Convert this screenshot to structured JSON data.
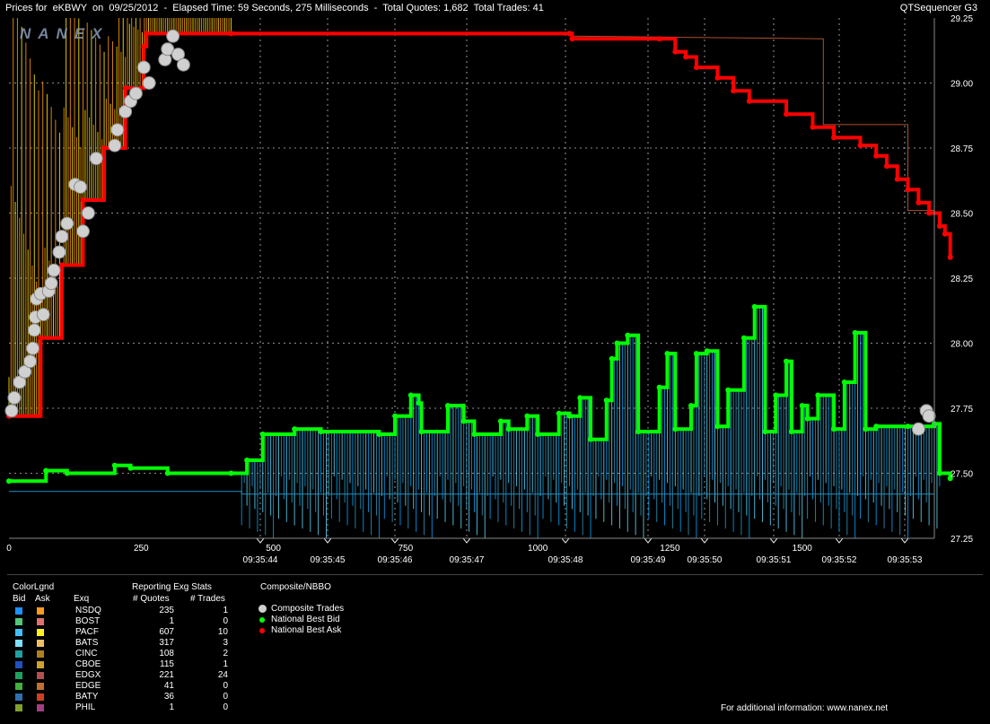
{
  "title": {
    "left": "Prices for  eKBWY  on  09/25/2012  -  Elapsed Time: 59 Seconds, 275 Milliseconds  -  Total Quotes: 1,682  Total Trades: 41",
    "right": "QTSequencer G3",
    "watermark": "NANEX"
  },
  "chart_data": {
    "type": "line",
    "y_axis": {
      "ticks": [
        "29.25",
        "29.00",
        "28.75",
        "28.50",
        "28.25",
        "28.00",
        "27.75",
        "27.50",
        "27.25"
      ],
      "ylim": [
        27.25,
        29.25
      ],
      "side": "right"
    },
    "x_axis_sequence": {
      "ticks": [
        "0",
        "250",
        "500",
        "750",
        "1000",
        "1250",
        "1500"
      ],
      "xlim": [
        0,
        1750
      ]
    },
    "x_axis_time": {
      "ticks": [
        "09:35:44",
        "09:35:45",
        "09:35:46",
        "09:35:47",
        "09:35:48",
        "09:35:49",
        "09:35:50",
        "09:35:51",
        "09:35:52",
        "09:35:53"
      ]
    },
    "grid": true,
    "colors": {
      "bid": "#00ff00",
      "ask": "#ff0000",
      "trade": "#d0d0d0",
      "nsdq_ask": "#ff9900",
      "pacf_ask": "#ffee00",
      "nsdq_bid": "#00aaff",
      "bats_bid": "#66ddff",
      "edgx_bid": "#3399bb"
    },
    "series": [
      {
        "name": "National Best Ask",
        "points": [
          [
            0,
            27.72
          ],
          [
            60,
            28.02
          ],
          [
            100,
            28.3
          ],
          [
            140,
            28.55
          ],
          [
            180,
            28.75
          ],
          [
            220,
            28.98
          ],
          [
            255,
            29.14
          ],
          [
            260,
            29.19
          ],
          [
            420,
            29.19
          ],
          [
            1060,
            29.19
          ],
          [
            1065,
            29.17
          ],
          [
            1230,
            29.17
          ],
          [
            1260,
            29.12
          ],
          [
            1280,
            29.1
          ],
          [
            1300,
            29.06
          ],
          [
            1340,
            29.02
          ],
          [
            1370,
            28.97
          ],
          [
            1400,
            28.93
          ],
          [
            1470,
            28.88
          ],
          [
            1520,
            28.83
          ],
          [
            1560,
            28.79
          ],
          [
            1610,
            28.76
          ],
          [
            1640,
            28.72
          ],
          [
            1660,
            28.68
          ],
          [
            1680,
            28.63
          ],
          [
            1700,
            28.59
          ],
          [
            1720,
            28.54
          ],
          [
            1740,
            28.5
          ],
          [
            1760,
            28.45
          ],
          [
            1770,
            28.42
          ],
          [
            1780,
            28.33
          ]
        ]
      },
      {
        "name": "National Best Bid",
        "points": [
          [
            0,
            27.47
          ],
          [
            70,
            27.51
          ],
          [
            110,
            27.5
          ],
          [
            200,
            27.53
          ],
          [
            230,
            27.52
          ],
          [
            300,
            27.5
          ],
          [
            420,
            27.5
          ],
          [
            450,
            27.55
          ],
          [
            480,
            27.65
          ],
          [
            540,
            27.67
          ],
          [
            590,
            27.66
          ],
          [
            700,
            27.65
          ],
          [
            730,
            27.72
          ],
          [
            760,
            27.8
          ],
          [
            775,
            27.77
          ],
          [
            780,
            27.66
          ],
          [
            830,
            27.76
          ],
          [
            860,
            27.7
          ],
          [
            880,
            27.65
          ],
          [
            930,
            27.7
          ],
          [
            945,
            27.67
          ],
          [
            980,
            27.72
          ],
          [
            1000,
            27.65
          ],
          [
            1040,
            27.73
          ],
          [
            1060,
            27.72
          ],
          [
            1080,
            27.79
          ],
          [
            1100,
            27.63
          ],
          [
            1130,
            27.78
          ],
          [
            1140,
            27.94
          ],
          [
            1150,
            28.0
          ],
          [
            1170,
            28.03
          ],
          [
            1190,
            27.66
          ],
          [
            1230,
            27.83
          ],
          [
            1245,
            27.96
          ],
          [
            1260,
            27.67
          ],
          [
            1290,
            27.76
          ],
          [
            1300,
            27.96
          ],
          [
            1320,
            27.97
          ],
          [
            1340,
            27.68
          ],
          [
            1360,
            27.82
          ],
          [
            1390,
            28.02
          ],
          [
            1410,
            28.14
          ],
          [
            1430,
            27.66
          ],
          [
            1450,
            27.8
          ],
          [
            1470,
            27.93
          ],
          [
            1480,
            27.66
          ],
          [
            1500,
            27.76
          ],
          [
            1510,
            27.71
          ],
          [
            1530,
            27.8
          ],
          [
            1560,
            27.67
          ],
          [
            1580,
            27.85
          ],
          [
            1600,
            28.04
          ],
          [
            1620,
            27.67
          ],
          [
            1640,
            27.68
          ],
          [
            1700,
            27.68
          ],
          [
            1750,
            27.69
          ],
          [
            1760,
            27.5
          ],
          [
            1780,
            27.48
          ]
        ]
      },
      {
        "name": "Composite Trades",
        "points": [
          [
            5,
            27.74
          ],
          [
            10,
            27.79
          ],
          [
            20,
            27.85
          ],
          [
            30,
            27.89
          ],
          [
            40,
            27.93
          ],
          [
            45,
            27.98
          ],
          [
            48,
            28.05
          ],
          [
            50,
            28.1
          ],
          [
            52,
            28.17
          ],
          [
            60,
            28.19
          ],
          [
            65,
            28.11
          ],
          [
            75,
            28.2
          ],
          [
            80,
            28.23
          ],
          [
            85,
            28.28
          ],
          [
            95,
            28.35
          ],
          [
            100,
            28.41
          ],
          [
            110,
            28.46
          ],
          [
            125,
            28.61
          ],
          [
            135,
            28.6
          ],
          [
            140,
            28.43
          ],
          [
            150,
            28.5
          ],
          [
            165,
            28.71
          ],
          [
            200,
            28.76
          ],
          [
            205,
            28.82
          ],
          [
            220,
            28.89
          ],
          [
            230,
            28.93
          ],
          [
            240,
            28.96
          ],
          [
            255,
            29.06
          ],
          [
            265,
            29.0
          ],
          [
            295,
            29.09
          ],
          [
            300,
            29.13
          ],
          [
            310,
            29.18
          ],
          [
            320,
            29.11
          ],
          [
            330,
            29.07
          ],
          [
            1720,
            27.67
          ],
          [
            1735,
            27.74
          ],
          [
            1740,
            27.72
          ]
        ]
      }
    ]
  },
  "legend": {
    "header_colorlgnd": "ColorLgnd",
    "header_bid": "Bid",
    "header_ask": "Ask",
    "header_exq": "Exq",
    "header_stats": "Reporting Exg Stats",
    "header_quotes": "# Quotes",
    "header_trades": "# Trades",
    "header_composite": "Composite/NBBO",
    "composite_items": [
      {
        "label": "Composite Trades",
        "color": "#d0d0d0"
      },
      {
        "label": "National Best Bid",
        "color": "#00ff00"
      },
      {
        "label": "National Best Ask",
        "color": "#ff0000"
      }
    ],
    "rows": [
      {
        "exq": "NSDQ",
        "quotes": "235",
        "trades": "1",
        "bid": "#1e90ff",
        "ask": "#ff9a20"
      },
      {
        "exq": "BOST",
        "quotes": "1",
        "trades": "0",
        "bid": "#50c878",
        "ask": "#e07070"
      },
      {
        "exq": "PACF",
        "quotes": "607",
        "trades": "10",
        "bid": "#40c0ff",
        "ask": "#ffee22"
      },
      {
        "exq": "BATS",
        "quotes": "317",
        "trades": "3",
        "bid": "#80e0ff",
        "ask": "#f0c060"
      },
      {
        "exq": "CINC",
        "quotes": "108",
        "trades": "2",
        "bid": "#20a0a0",
        "ask": "#b08020"
      },
      {
        "exq": "CBOE",
        "quotes": "115",
        "trades": "1",
        "bid": "#2050c0",
        "ask": "#d0a030"
      },
      {
        "exq": "EDGX",
        "quotes": "221",
        "trades": "24",
        "bid": "#20a060",
        "ask": "#b05050"
      },
      {
        "exq": "EDGE",
        "quotes": "41",
        "trades": "0",
        "bid": "#40b040",
        "ask": "#c07030"
      },
      {
        "exq": "BATY",
        "quotes": "36",
        "trades": "0",
        "bid": "#3070b0",
        "ask": "#d04020"
      },
      {
        "exq": "PHIL",
        "quotes": "1",
        "trades": "0",
        "bid": "#80a030",
        "ask": "#a04080"
      }
    ],
    "footer": "For additional information: www.nanex.net"
  }
}
